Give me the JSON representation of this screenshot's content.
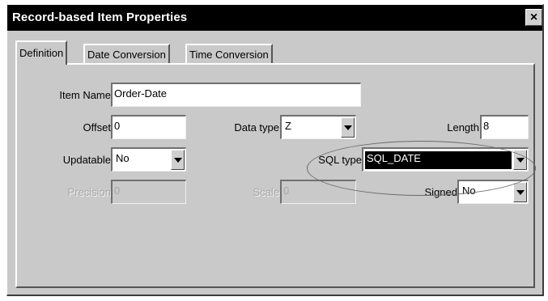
{
  "window": {
    "title": "Record-based Item Properties",
    "close_label": "×"
  },
  "tabs": [
    {
      "label": "Definition",
      "active": true
    },
    {
      "label": "Date Conversion",
      "active": false
    },
    {
      "label": "Time Conversion",
      "active": false
    }
  ],
  "fields": {
    "item_name": {
      "label": "Item Name",
      "value": "Order-Date"
    },
    "offset": {
      "label": "Offset",
      "value": "0"
    },
    "data_type": {
      "label": "Data type",
      "value": "Z"
    },
    "length": {
      "label": "Length",
      "value": "8"
    },
    "updatable": {
      "label": "Updatable",
      "value": "No"
    },
    "sql_type": {
      "label": "SQL type",
      "value": "SQL_DATE"
    },
    "precision": {
      "label": "Precision",
      "value": "0",
      "disabled": true
    },
    "scale": {
      "label": "Scale",
      "value": "0",
      "disabled": true
    },
    "signed": {
      "label": "Signed",
      "value": "No"
    }
  },
  "icons": {
    "close": "close-icon",
    "dropdown": "chevron-down-icon"
  }
}
